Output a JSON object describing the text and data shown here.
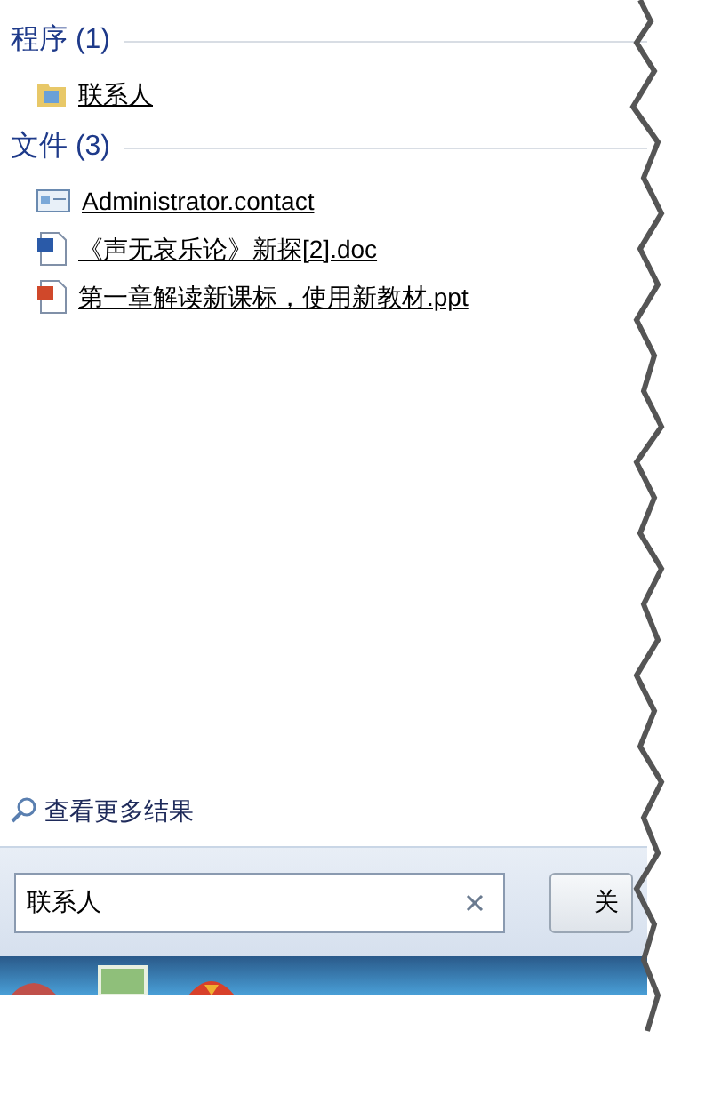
{
  "groups": [
    {
      "heading": "程序 (1)",
      "items": [
        {
          "kind": "folder",
          "label": "联系人"
        }
      ]
    },
    {
      "heading": "文件 (3)",
      "items": [
        {
          "kind": "contact",
          "label": "Administrator.contact"
        },
        {
          "kind": "doc",
          "label": "《声无哀乐论》新探[2].doc"
        },
        {
          "kind": "ppt",
          "label": "第一章解读新课标，使用新教材.ppt"
        }
      ]
    }
  ],
  "more_results": "查看更多结果",
  "search": {
    "value": "联系人"
  },
  "shutdown_button": "关"
}
